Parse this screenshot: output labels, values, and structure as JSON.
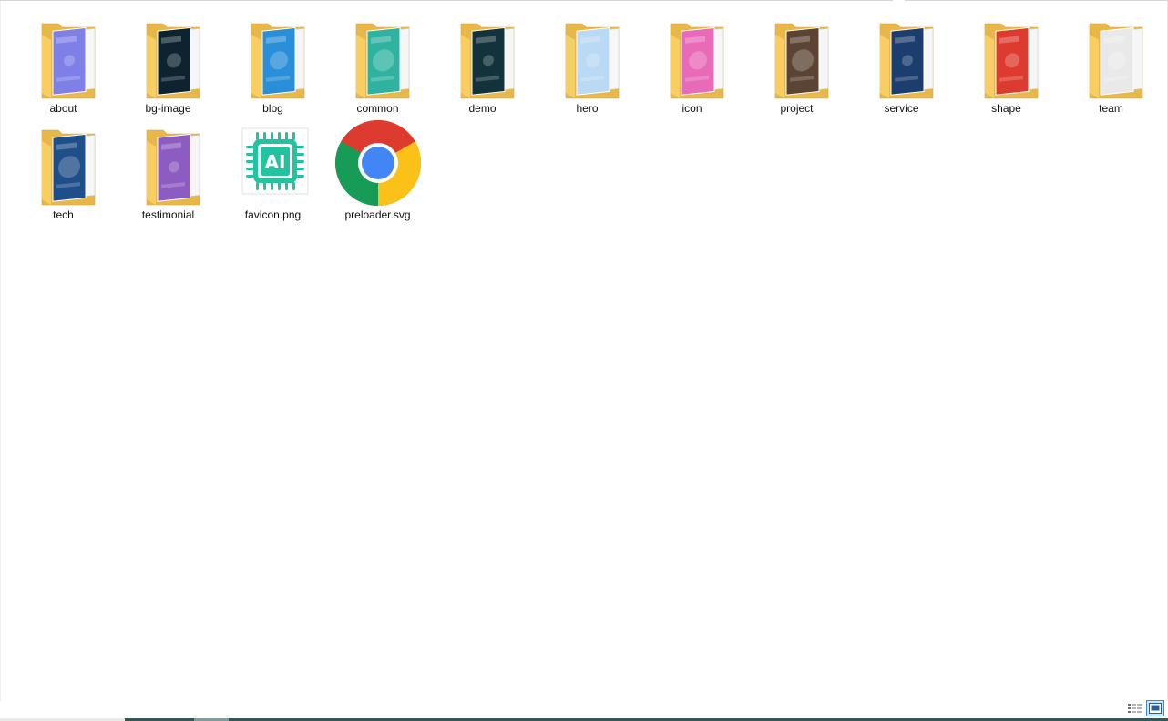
{
  "items": [
    {
      "label": "about",
      "type": "folder",
      "accent": "#7f7fe8"
    },
    {
      "label": "bg-image",
      "type": "folder",
      "accent": "#0d2430"
    },
    {
      "label": "blog",
      "type": "folder",
      "accent": "#2a8fd8"
    },
    {
      "label": "common",
      "type": "folder",
      "accent": "#2fb3a0"
    },
    {
      "label": "demo",
      "type": "folder",
      "accent": "#14323b"
    },
    {
      "label": "hero",
      "type": "folder",
      "accent": "#b9d9f4"
    },
    {
      "label": "icon",
      "type": "folder",
      "accent": "#e86ab8"
    },
    {
      "label": "project",
      "type": "folder",
      "accent": "#5b4433"
    },
    {
      "label": "service",
      "type": "folder",
      "accent": "#1c3e6e"
    },
    {
      "label": "shape",
      "type": "folder",
      "accent": "#dd3b2f"
    },
    {
      "label": "team",
      "type": "folder",
      "accent": "#e9e9e9"
    },
    {
      "label": "tech",
      "type": "folder",
      "accent": "#1f4f8a"
    },
    {
      "label": "testimonial",
      "type": "folder",
      "accent": "#8d5cc2"
    },
    {
      "label": "favicon.png",
      "type": "image-file",
      "accent": "#22c3a0",
      "text": "AI"
    },
    {
      "label": "preloader.svg",
      "type": "chrome-file",
      "accent": "#4285f4"
    }
  ],
  "statusbar": {
    "details_view_icon": "details-view-icon",
    "large_icons_view_icon": "large-icons-view-icon",
    "active_view": "large-icons"
  },
  "colors": {
    "folder_back": "#e8b74a",
    "folder_front": "#fcd679",
    "selection": "#cce4f7",
    "selection_border": "#3c8ad8"
  }
}
